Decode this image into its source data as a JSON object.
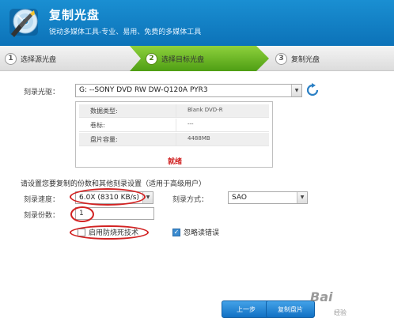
{
  "header": {
    "title": "复制光盘",
    "subtitle": "锐动多媒体工具-专业、易用、免费的多媒体工具"
  },
  "steps": [
    {
      "num": "1",
      "label": "选择源光盘",
      "active": false
    },
    {
      "num": "2",
      "label": "选择目标光盘",
      "active": true
    },
    {
      "num": "3",
      "label": "复制光盘",
      "active": false
    }
  ],
  "drive": {
    "label": "刻录光驱：",
    "value": "G:  --SONY     DVD RW DW-Q120A   PYR3"
  },
  "info": {
    "rows": [
      {
        "key": "数据类型:",
        "value": "Blank DVD-R"
      },
      {
        "key": "卷标:",
        "value": "---"
      },
      {
        "key": "盘片容量:",
        "value": "4488MB"
      }
    ],
    "status": "就绪"
  },
  "settings": {
    "hint": "请设置您要复制的份数和其他刻录设置（适用于高级用户）",
    "speed_label": "刻录速度：",
    "speed_value": "6.0X  (8310 KB/s)",
    "method_label": "刻录方式：",
    "method_value": "SAO",
    "copies_label": "刻录份数：",
    "copies_value": "1",
    "burnproof_label": "启用防烧死技术",
    "burnproof_checked": false,
    "ignore_errors_label": "忽略读错误",
    "ignore_errors_checked": true
  },
  "buttons": {
    "prev": "上一步",
    "next": "复制盘片"
  },
  "watermark": {
    "brand": "Bai",
    "sub": "经验"
  },
  "colors": {
    "header": "#1a8fd2",
    "active_step": "#5fb222",
    "status_red": "#d02020",
    "annotation_red": "#d22222",
    "button_blue": "#1271c4"
  }
}
